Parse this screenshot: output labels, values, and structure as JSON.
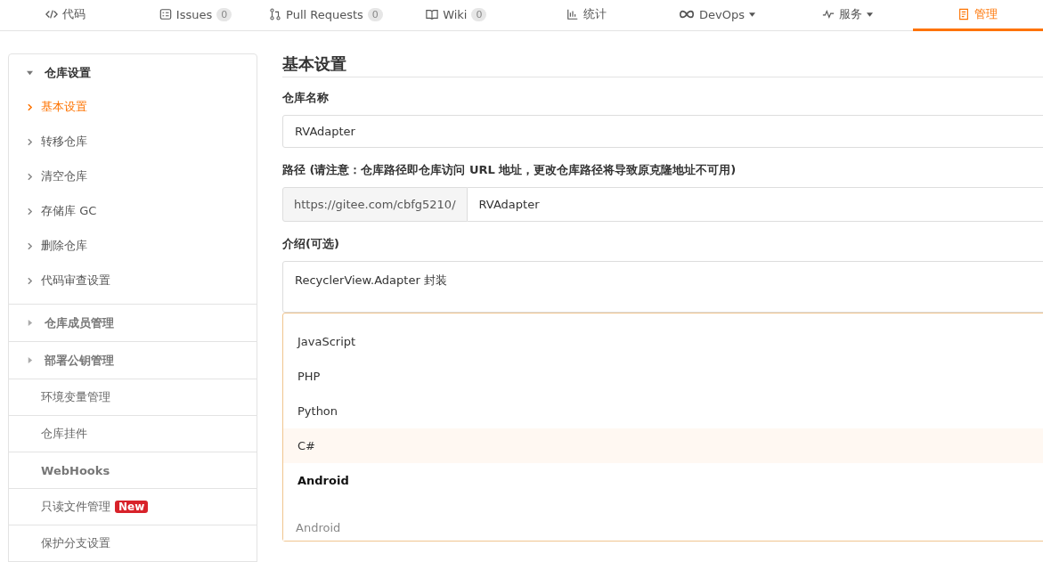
{
  "nav_tabs": [
    {
      "label": "代码",
      "selected": false
    },
    {
      "label": "Issues",
      "count": "0",
      "selected": false
    },
    {
      "label": "Pull Requests",
      "count": "0",
      "selected": false
    },
    {
      "label": "Wiki",
      "count": "0",
      "selected": false
    },
    {
      "label": "统计",
      "selected": false
    },
    {
      "label": "DevOps",
      "dropdown": true,
      "selected": false
    },
    {
      "label": "服务",
      "dropdown": true,
      "selected": false
    },
    {
      "label": "管理",
      "selected": true
    }
  ],
  "sidebar": {
    "items": [
      {
        "kind": "group",
        "label": "仓库设置",
        "expanded": true,
        "children": [
          {
            "label": "基本设置",
            "selected": true
          },
          {
            "label": "转移仓库",
            "selected": false
          },
          {
            "label": "清空仓库",
            "selected": false
          },
          {
            "label": "存储库 GC",
            "selected": false
          },
          {
            "label": "删除仓库",
            "selected": false
          },
          {
            "label": "代码审查设置",
            "selected": false
          }
        ]
      },
      {
        "kind": "group",
        "label": "仓库成员管理",
        "expanded": false
      },
      {
        "kind": "group",
        "label": "部署公钥管理",
        "expanded": false
      },
      {
        "kind": "link",
        "label": "环境变量管理"
      },
      {
        "kind": "link",
        "label": "仓库挂件"
      },
      {
        "kind": "link",
        "label": "WebHooks"
      },
      {
        "kind": "link",
        "label": "只读文件管理",
        "badge": "New"
      },
      {
        "kind": "link",
        "label": "保护分支设置"
      }
    ]
  },
  "main": {
    "title": "基本设置",
    "name_label": "仓库名称",
    "name_value": "RVAdapter",
    "path_label": "路径 (请注意：仓库路径即仓库访问 URL 地址，更改仓库路径将导致原克隆地址不可用)",
    "path_prefix": "https://gitee.com/cbfg5210/",
    "path_value": "RVAdapter",
    "desc_label": "介绍(可选)",
    "desc_value": "RecyclerView.Adapter 封装",
    "language_dropdown": {
      "options": [
        {
          "label": "JavaScript",
          "selected": false,
          "hovered": false
        },
        {
          "label": "PHP",
          "selected": false,
          "hovered": false
        },
        {
          "label": "Python",
          "selected": false,
          "hovered": false
        },
        {
          "label": "C#",
          "selected": false,
          "hovered": true
        },
        {
          "label": "Android",
          "selected": true,
          "hovered": false
        }
      ],
      "placeholder": "Android"
    }
  }
}
